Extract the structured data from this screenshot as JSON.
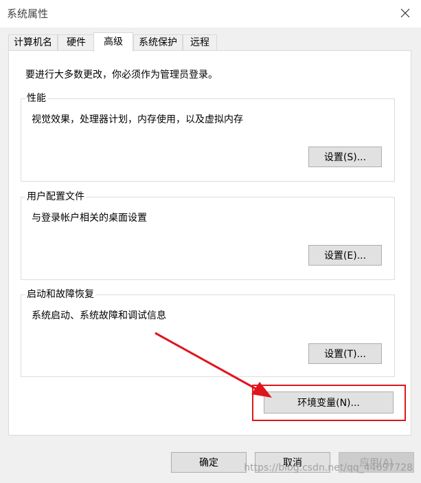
{
  "window": {
    "title": "系统属性"
  },
  "tabs": [
    "计算机名",
    "硬件",
    "高级",
    "系统保护",
    "远程"
  ],
  "active_tab": "高级",
  "notice": "要进行大多数更改，你必须作为管理员登录。",
  "groups": {
    "performance": {
      "label": "性能",
      "description": "视觉效果，处理器计划，内存使用，以及虚拟内存",
      "button": "设置(S)..."
    },
    "user_profiles": {
      "label": "用户配置文件",
      "description": "与登录帐户相关的桌面设置",
      "button": "设置(E)..."
    },
    "startup_recovery": {
      "label": "启动和故障恢复",
      "description": "系统启动、系统故障和调试信息",
      "button": "设置(T)..."
    }
  },
  "env_button": "环境变量(N)...",
  "footer": {
    "ok": "确定",
    "cancel": "取消",
    "apply": "应用(A)"
  },
  "watermark": "https://blog.csdn.net/qq_44697728",
  "colors": {
    "annotation_red": "#e0151c",
    "accent": "#0078d7"
  }
}
